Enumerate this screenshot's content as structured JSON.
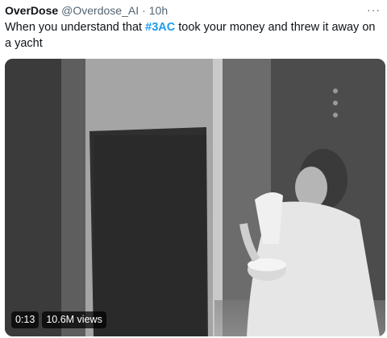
{
  "tweet": {
    "display_name": "OverDose",
    "handle": "@Overdose_AI",
    "separator": "·",
    "time": "10h",
    "more_icon": "···",
    "text_before": "When you understand that ",
    "hashtag": "#3AC",
    "text_after": " took your money and threw it away on a yacht"
  },
  "video": {
    "duration": "0:13",
    "views": "10.6M views"
  }
}
